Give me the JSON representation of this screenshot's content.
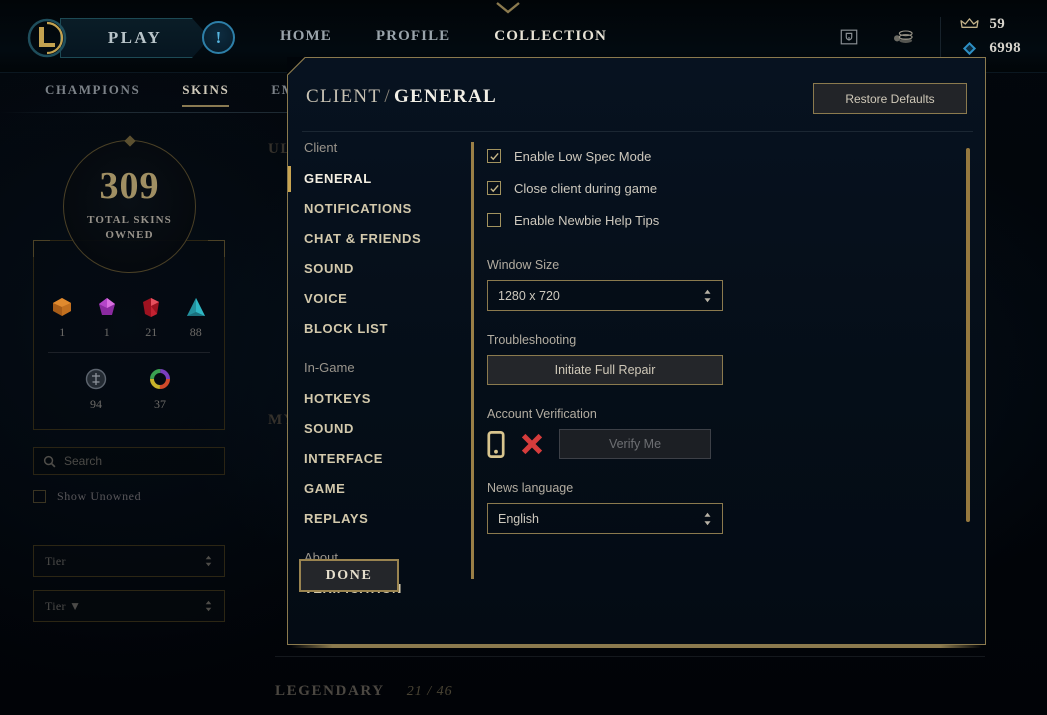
{
  "topbar": {
    "play_label": "PLAY",
    "alert_icon": "exclamation-circle-icon",
    "chevron_icon": "chevron-down-icon",
    "nav": [
      {
        "label": "HOME",
        "active": false
      },
      {
        "label": "PROFILE",
        "active": false
      },
      {
        "label": "COLLECTION",
        "active": true
      }
    ],
    "icons": [
      {
        "name": "loot-chest-icon"
      },
      {
        "name": "store-coins-icon"
      }
    ],
    "currencies": [
      {
        "icon": "riot-points-icon",
        "value": "59",
        "color": "#c9b27a"
      },
      {
        "icon": "blue-essence-icon",
        "value": "6998",
        "color": "#2d8fc4"
      }
    ]
  },
  "subnav": [
    {
      "label": "CHAMPIONS",
      "active": false
    },
    {
      "label": "SKINS",
      "active": true
    },
    {
      "label": "EMOTES",
      "active": false
    }
  ],
  "collection": {
    "total_skins_number": "309",
    "total_skins_label_line1": "TOTAL SKINS",
    "total_skins_label_line2": "OWNED",
    "tier_counts_row1": [
      {
        "tier": "ultimate",
        "count": "1",
        "color": "#e08a2e"
      },
      {
        "tier": "mythic",
        "count": "1",
        "color": "#c64fd0"
      },
      {
        "tier": "legendary",
        "count": "21",
        "color": "#d0323c"
      },
      {
        "tier": "epic",
        "count": "88",
        "color": "#2fb7c4"
      }
    ],
    "tier_counts_row2": [
      {
        "tier": "standard",
        "count": "94",
        "color": "#7a8490"
      },
      {
        "tier": "chromas",
        "count": "37",
        "color": "#7bbf3a"
      }
    ],
    "search_placeholder": "Search",
    "search_value": "",
    "search_icon": "search-icon",
    "show_unowned_label": "Show Unowned",
    "show_unowned_checked": false,
    "filter_tier_1": "Tier",
    "filter_tier_2": "Tier ▼",
    "section_legendary_label": "LEGENDARY",
    "section_legendary_count": "21 / 46",
    "hidden_section_ultimate": "ULTIMATE",
    "hidden_section_mythic": "MYTHIC"
  },
  "settings_modal": {
    "title_client": "CLIENT",
    "title_separator": "/",
    "title_section": "GENERAL",
    "restore_defaults_label": "Restore Defaults",
    "done_label": "DONE",
    "sidebar": {
      "group_client_label": "Client",
      "client_items": [
        {
          "label": "GENERAL",
          "active": true
        },
        {
          "label": "NOTIFICATIONS",
          "active": false
        },
        {
          "label": "CHAT & FRIENDS",
          "active": false
        },
        {
          "label": "SOUND",
          "active": false
        },
        {
          "label": "VOICE",
          "active": false
        },
        {
          "label": "BLOCK LIST",
          "active": false
        }
      ],
      "group_ingame_label": "In-Game",
      "ingame_items": [
        {
          "label": "HOTKEYS",
          "active": false
        },
        {
          "label": "SOUND",
          "active": false
        },
        {
          "label": "INTERFACE",
          "active": false
        },
        {
          "label": "GAME",
          "active": false
        },
        {
          "label": "REPLAYS",
          "active": false
        }
      ],
      "group_about_label": "About",
      "about_items": [
        {
          "label": "VERIFICATION",
          "active": false
        }
      ]
    },
    "content": {
      "checkboxes": [
        {
          "label": "Enable Low Spec Mode",
          "checked": true
        },
        {
          "label": "Close client during game",
          "checked": true
        },
        {
          "label": "Enable Newbie Help Tips",
          "checked": false
        }
      ],
      "window_size_label": "Window Size",
      "window_size_value": "1280 x 720",
      "troubleshooting_label": "Troubleshooting",
      "initiate_full_repair_label": "Initiate Full Repair",
      "account_verification_label": "Account Verification",
      "phone_icon": "mobile-phone-icon",
      "status_icon": "red-x-icon",
      "verify_me_label": "Verify Me",
      "verify_me_disabled": true,
      "news_language_label": "News language",
      "news_language_value": "English"
    }
  },
  "theme": {
    "gold": "#8b7a4e",
    "gold_bright": "#c8a451",
    "text_primary": "#cdc8bd",
    "modal_bg": "#071220",
    "red": "#d63c3c"
  }
}
